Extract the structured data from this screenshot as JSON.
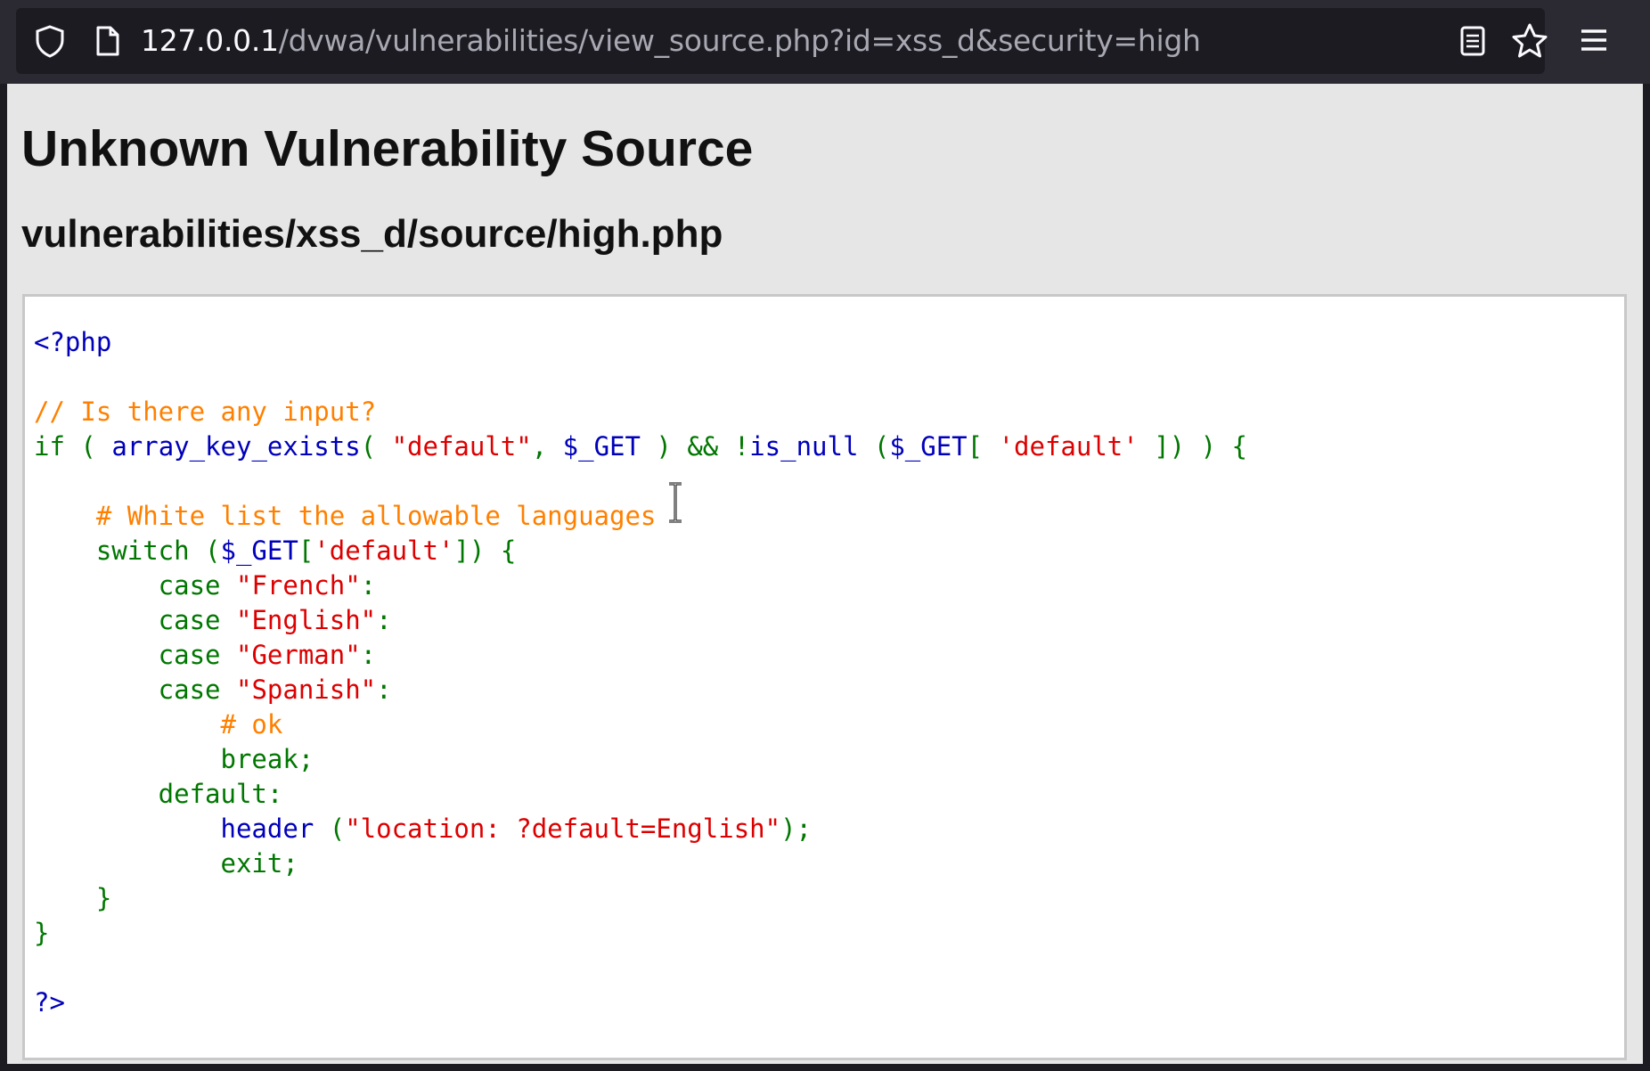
{
  "browser": {
    "url_host": "127.0.0.1",
    "url_path": "/dvwa/vulnerabilities/view_source.php?id=xss_d&security=high",
    "icons": {
      "shield": "tracking-protection-icon",
      "page": "page-info-icon",
      "reader": "reader-view-icon",
      "star": "bookmark-star-icon",
      "menu": "hamburger-menu-icon"
    }
  },
  "page": {
    "title": "Unknown Vulnerability Source",
    "file_path": "vulnerabilities/xss_d/source/high.php"
  },
  "code": {
    "lines": [
      [
        {
          "t": "<?php",
          "c": "fn"
        }
      ],
      [],
      [
        {
          "t": "// Is there any input?",
          "c": "cm"
        }
      ],
      [
        {
          "t": "if ( ",
          "c": "kw"
        },
        {
          "t": "array_key_exists",
          "c": "fn"
        },
        {
          "t": "( ",
          "c": "kw"
        },
        {
          "t": "\"default\"",
          "c": "str"
        },
        {
          "t": ", ",
          "c": "kw"
        },
        {
          "t": "$_GET ",
          "c": "fn"
        },
        {
          "t": ") && !",
          "c": "kw"
        },
        {
          "t": "is_null ",
          "c": "fn"
        },
        {
          "t": "(",
          "c": "kw"
        },
        {
          "t": "$_GET",
          "c": "fn"
        },
        {
          "t": "[ ",
          "c": "kw"
        },
        {
          "t": "'default' ",
          "c": "str"
        },
        {
          "t": "]) ) {",
          "c": "kw"
        }
      ],
      [],
      [
        {
          "t": "    # White list the allowable languages",
          "c": "cm"
        }
      ],
      [
        {
          "t": "    switch (",
          "c": "kw"
        },
        {
          "t": "$_GET",
          "c": "fn"
        },
        {
          "t": "[",
          "c": "kw"
        },
        {
          "t": "'default'",
          "c": "str"
        },
        {
          "t": "]) {",
          "c": "kw"
        }
      ],
      [
        {
          "t": "        case ",
          "c": "kw"
        },
        {
          "t": "\"French\"",
          "c": "str"
        },
        {
          "t": ":",
          "c": "kw"
        }
      ],
      [
        {
          "t": "        case ",
          "c": "kw"
        },
        {
          "t": "\"English\"",
          "c": "str"
        },
        {
          "t": ":",
          "c": "kw"
        }
      ],
      [
        {
          "t": "        case ",
          "c": "kw"
        },
        {
          "t": "\"German\"",
          "c": "str"
        },
        {
          "t": ":",
          "c": "kw"
        }
      ],
      [
        {
          "t": "        case ",
          "c": "kw"
        },
        {
          "t": "\"Spanish\"",
          "c": "str"
        },
        {
          "t": ":",
          "c": "kw"
        }
      ],
      [
        {
          "t": "            # ok",
          "c": "cm"
        }
      ],
      [
        {
          "t": "            break;",
          "c": "kw"
        }
      ],
      [
        {
          "t": "        default:",
          "c": "kw"
        }
      ],
      [
        {
          "t": "            ",
          "c": "kw"
        },
        {
          "t": "header ",
          "c": "fn"
        },
        {
          "t": "(",
          "c": "kw"
        },
        {
          "t": "\"location: ?default=English\"",
          "c": "str"
        },
        {
          "t": ");",
          "c": "kw"
        }
      ],
      [
        {
          "t": "            exit;",
          "c": "kw"
        }
      ],
      [
        {
          "t": "    }",
          "c": "kw"
        }
      ],
      [
        {
          "t": "}",
          "c": "kw"
        }
      ],
      [],
      [
        {
          "t": "?>",
          "c": "fn"
        }
      ]
    ]
  },
  "colors": {
    "keyword": "#007700",
    "function": "#0000bb",
    "string": "#dd0000",
    "comment": "#ff8000"
  }
}
